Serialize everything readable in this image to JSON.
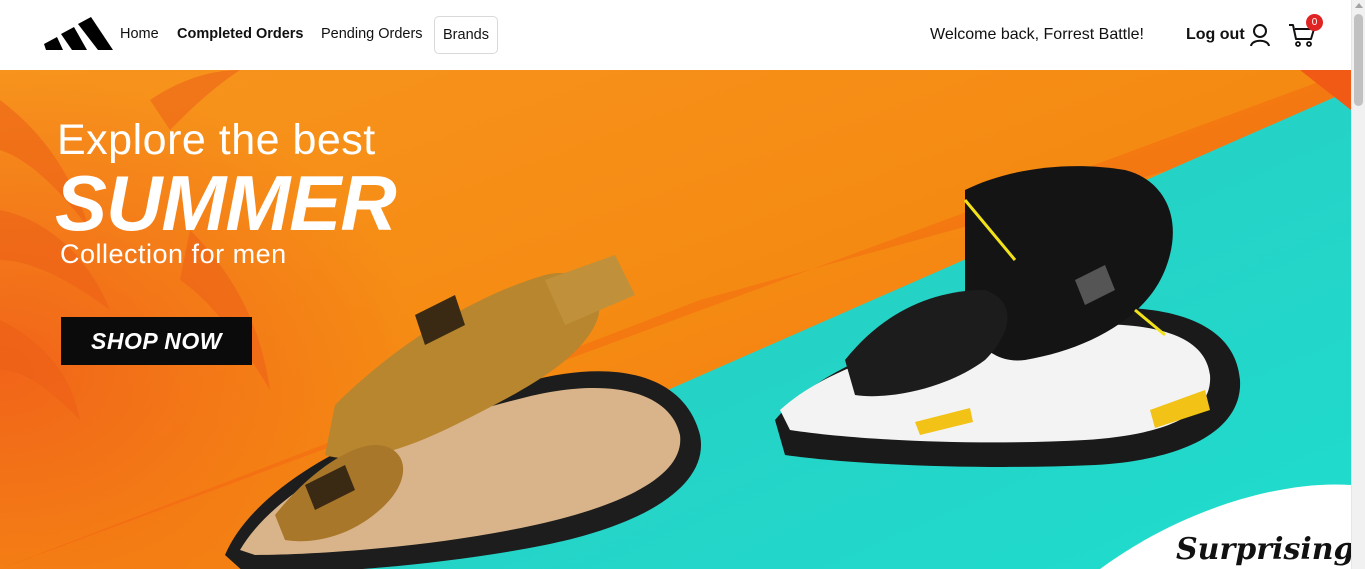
{
  "navbar": {
    "logo_icon": "adidas-stripes-logo",
    "links": {
      "home": "Home",
      "completed_orders": "Completed Orders",
      "pending_orders": "Pending Orders",
      "brands": "Brands"
    },
    "welcome": "Welcome back, Forrest Battle!",
    "logout": "Log out",
    "user_icon": "user-icon",
    "cart_icon": "cart-icon",
    "cart_count": "0"
  },
  "hero": {
    "line1": "Explore the best",
    "line2": "SUMMER",
    "line3": "Collection for men",
    "cta": "SHOP NOW",
    "corner_text": "Surprisingly",
    "colors": {
      "orange": "#f58a12",
      "teal": "#25d4c8",
      "button": "#0b0b0b",
      "badge": "#e02424"
    }
  }
}
